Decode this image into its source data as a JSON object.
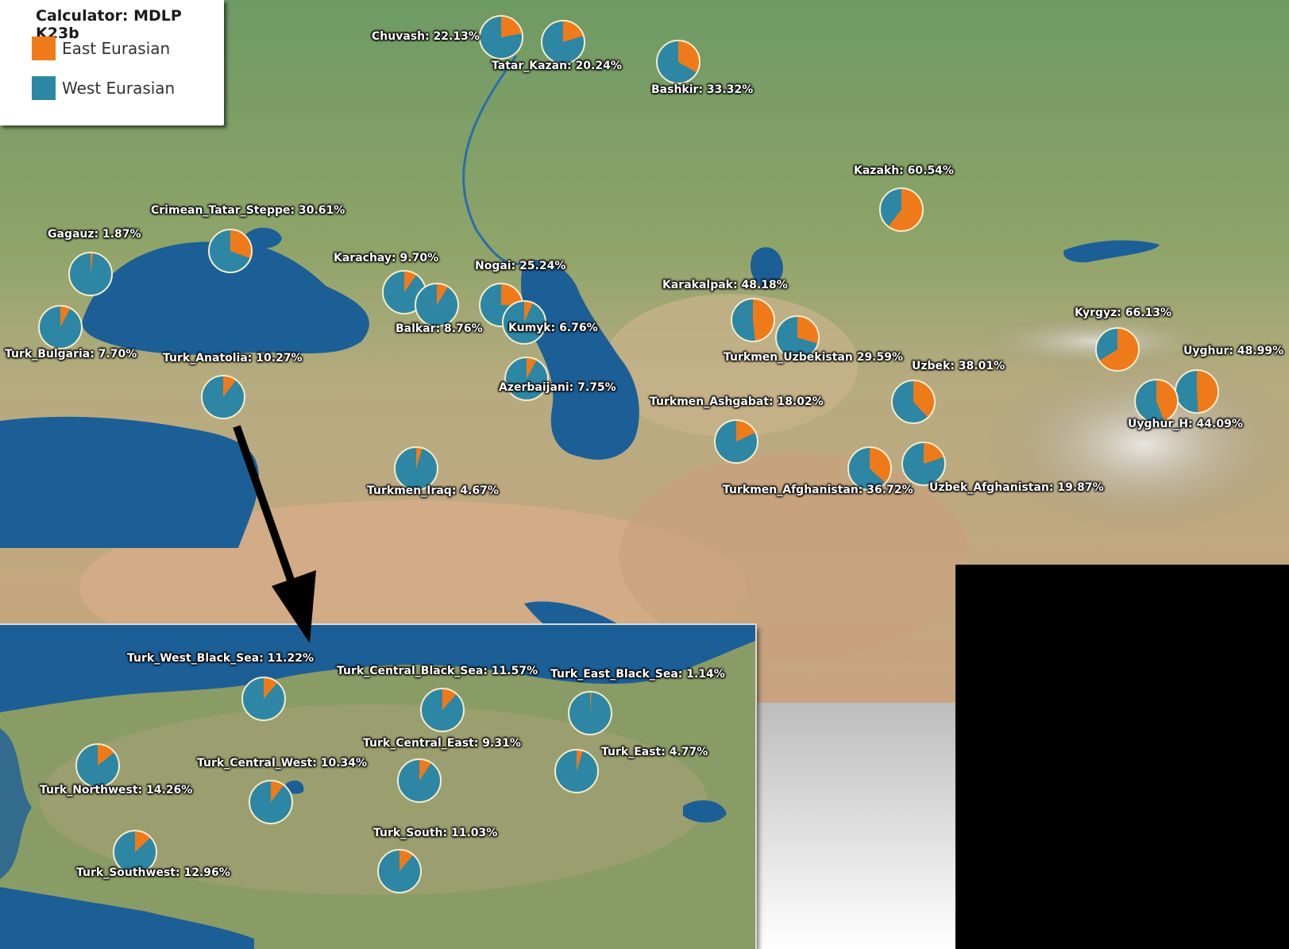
{
  "legend": {
    "title": "Calculator: MDLP K23b",
    "items": [
      {
        "label": "East Eurasian",
        "color": "#ef7a1a"
      },
      {
        "label": "West Eurasian",
        "color": "#2d87a4"
      }
    ]
  },
  "colors": {
    "east": "#ef7a1a",
    "west": "#2d87a4",
    "sea": "#1c5f97",
    "land": "#7f9a63",
    "desert": "#c9a47e",
    "pie_border": "#f5eccb"
  },
  "main_map": {
    "populations": [
      {
        "id": "chuvash",
        "label": "Chuvash: 22.13%",
        "east_pct": 22.13
      },
      {
        "id": "tatar-kazan",
        "label": "Tatar_Kazan: 20.24%",
        "east_pct": 20.24
      },
      {
        "id": "bashkir",
        "label": "Bashkir: 33.32%",
        "east_pct": 33.32
      },
      {
        "id": "kazakh",
        "label": "Kazakh: 60.54%",
        "east_pct": 60.54
      },
      {
        "id": "crimean-tatar-steppe",
        "label": "Crimean_Tatar_Steppe: 30.61%",
        "east_pct": 30.61
      },
      {
        "id": "gagauz",
        "label": "Gagauz: 1.87%",
        "east_pct": 1.87
      },
      {
        "id": "turk-bulgaria",
        "label": "Turk_Bulgaria: 7.70%",
        "east_pct": 7.7
      },
      {
        "id": "karachay",
        "label": "Karachay: 9.70%",
        "east_pct": 9.7
      },
      {
        "id": "balkar",
        "label": "Balkar: 8.76%",
        "east_pct": 8.76
      },
      {
        "id": "nogai",
        "label": "Nogai: 25.24%",
        "east_pct": 25.24
      },
      {
        "id": "kumyk",
        "label": "Kumyk: 6.76%",
        "east_pct": 6.76
      },
      {
        "id": "azerbaijani",
        "label": "Azerbaijani: 7.75%",
        "east_pct": 7.75
      },
      {
        "id": "turk-anatolia",
        "label": "Turk_Anatolia: 10.27%",
        "east_pct": 10.27
      },
      {
        "id": "turkmen-iraq",
        "label": "Turkmen_Iraq: 4.67%",
        "east_pct": 4.67
      },
      {
        "id": "karakalpak",
        "label": "Karakalpak: 48.18%",
        "east_pct": 48.18
      },
      {
        "id": "turkmen-uzbekistan",
        "label": "Turkmen_Uzbekistan 29.59%",
        "east_pct": 29.59
      },
      {
        "id": "turkmen-ashgabat",
        "label": "Turkmen_Ashgabat: 18.02%",
        "east_pct": 18.02
      },
      {
        "id": "uzbek",
        "label": "Uzbek: 38.01%",
        "east_pct": 38.01
      },
      {
        "id": "turkmen-afghanistan",
        "label": "Turkmen_Afghanistan: 36.72%",
        "east_pct": 36.72
      },
      {
        "id": "uzbek-afghanistan",
        "label": "Uzbek_Afghanistan: 19.87%",
        "east_pct": 19.87
      },
      {
        "id": "kyrgyz",
        "label": "Kyrgyz: 66.13%",
        "east_pct": 66.13
      },
      {
        "id": "uyghur",
        "label": "Uyghur: 48.99%",
        "east_pct": 48.99
      },
      {
        "id": "uyghur-h",
        "label": "Uyghur_H: 44.09%",
        "east_pct": 44.09
      }
    ]
  },
  "inset_map": {
    "populations": [
      {
        "id": "turk-west-black-sea",
        "label": "Turk_West_Black_Sea: 11.22%",
        "east_pct": 11.22
      },
      {
        "id": "turk-central-black-sea",
        "label": "Turk_Central_Black_Sea: 11.57%",
        "east_pct": 11.57
      },
      {
        "id": "turk-east-black-sea",
        "label": "Turk_East_Black_Sea: 1.14%",
        "east_pct": 1.14
      },
      {
        "id": "turk-northwest",
        "label": "Turk_Northwest: 14.26%",
        "east_pct": 14.26
      },
      {
        "id": "turk-central-west",
        "label": "Turk_Central_West: 10.34%",
        "east_pct": 10.34
      },
      {
        "id": "turk-central-east",
        "label": "Turk_Central_East: 9.31%",
        "east_pct": 9.31
      },
      {
        "id": "turk-east",
        "label": "Turk_East: 4.77%",
        "east_pct": 4.77
      },
      {
        "id": "turk-southwest",
        "label": "Turk_Southwest: 12.96%",
        "east_pct": 12.96
      },
      {
        "id": "turk-south",
        "label": "Turk_South: 11.03%",
        "east_pct": 11.03
      }
    ]
  }
}
